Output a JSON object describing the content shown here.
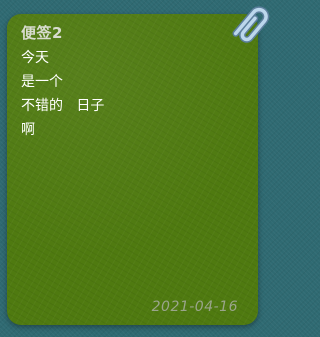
{
  "note": {
    "title": "便签2",
    "lines": [
      "今天",
      "是一个",
      "不错的   日子",
      "啊"
    ],
    "date": "2021-04-16"
  },
  "icons": {
    "clip": "paperclip-icon"
  },
  "colors": {
    "background": "#2f6a72",
    "note": "#4f7a10",
    "title": "#d8dccf",
    "date": "#9aa58b"
  }
}
